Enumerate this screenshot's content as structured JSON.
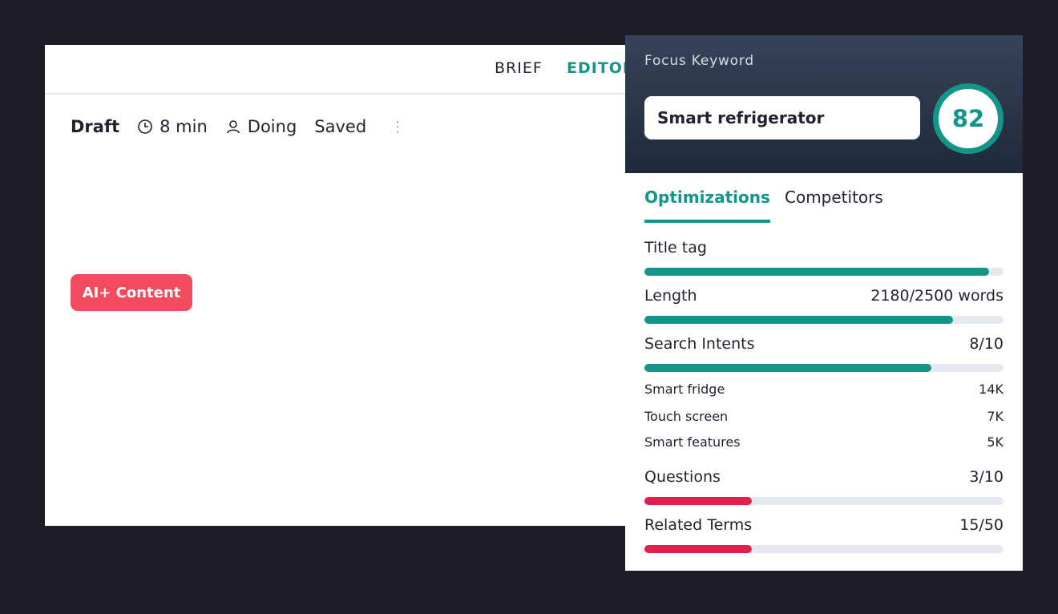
{
  "editor": {
    "tabs": {
      "brief": "BRIEF",
      "editor": "EDITOR"
    },
    "status": {
      "state": "Draft",
      "read_time": "8 min",
      "assignee_status": "Doing",
      "save_state": "Saved",
      "more": "⋮"
    },
    "ai_button": "AI+ Content"
  },
  "panel": {
    "focus_label": "Focus Keyword",
    "keyword": "Smart refrigerator",
    "score": "82",
    "tabs": {
      "optimizations": "Optimizations",
      "competitors": "Competitors"
    },
    "metrics": [
      {
        "label": "Title tag",
        "value": "",
        "progress": 0.96,
        "color": "#12968a"
      },
      {
        "label": "Length",
        "value": "2180/2500 words",
        "progress": 0.86,
        "color": "#12968a"
      },
      {
        "label": "Search Intents",
        "value": "8/10",
        "progress": 0.8,
        "color": "#12968a"
      },
      {
        "label": "Questions",
        "value": "3/10",
        "progress": 0.3,
        "color": "#e51f4b"
      },
      {
        "label": "Related Terms",
        "value": "15/50",
        "progress": 0.3,
        "color": "#e51f4b"
      }
    ],
    "intents": [
      {
        "label": "Smart fridge",
        "count": "14K"
      },
      {
        "label": "Touch screen",
        "count": "7K"
      },
      {
        "label": "Smart features",
        "count": "5K"
      }
    ]
  }
}
